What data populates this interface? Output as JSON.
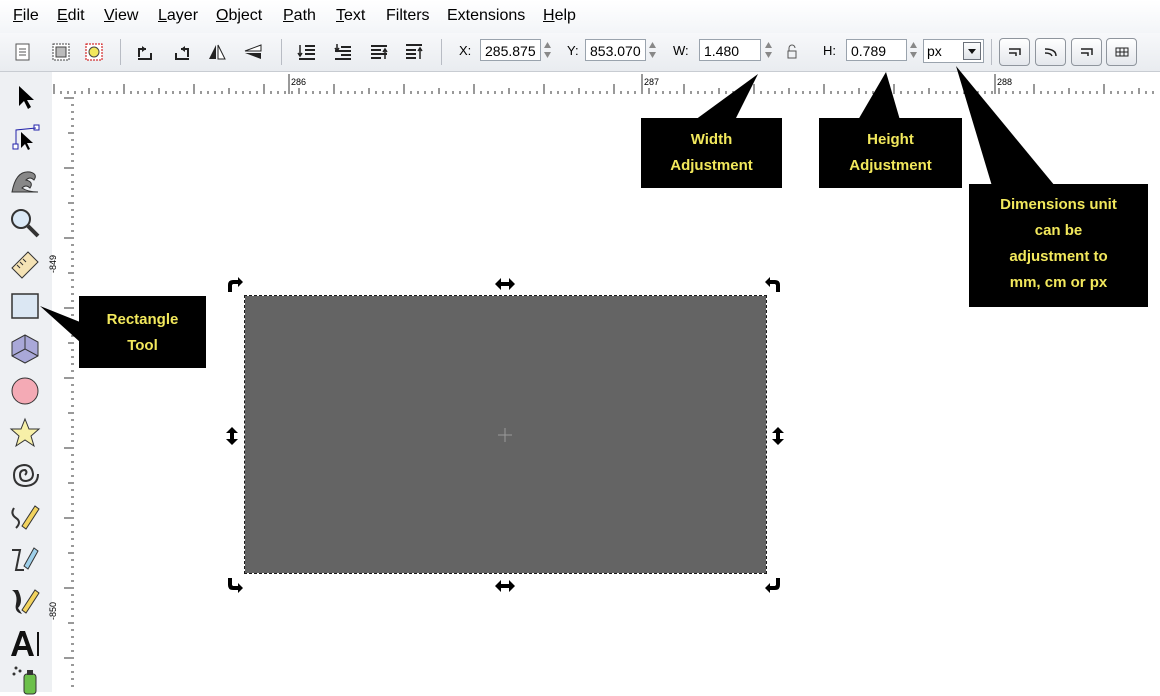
{
  "menu": {
    "items": [
      {
        "label": "File",
        "underline": "F",
        "rest": "ile"
      },
      {
        "label": "Edit",
        "underline": "E",
        "rest": "dit"
      },
      {
        "label": "View",
        "underline": "V",
        "rest": "iew"
      },
      {
        "label": "Layer",
        "underline": "L",
        "rest": "ayer"
      },
      {
        "label": "Object",
        "underline": "O",
        "rest": "bject"
      },
      {
        "label": "Path",
        "underline": "P",
        "rest": "ath"
      },
      {
        "label": "Text",
        "underline": "T",
        "rest": "ext"
      },
      {
        "label": "Filters",
        "underline": "",
        "rest": "Filters"
      },
      {
        "label": "Extensions",
        "underline": "",
        "rest": "Extensions"
      },
      {
        "label": "Help",
        "underline": "H",
        "rest": "elp"
      }
    ]
  },
  "toolbar": {
    "x_label": "X:",
    "x_value": "285.875",
    "y_label": "Y:",
    "y_value": "853.070",
    "w_label": "W:",
    "w_value": "1.480",
    "h_label": "H:",
    "h_value": "0.789",
    "unit_value": "px"
  },
  "ruler": {
    "h_labels": [
      "286",
      "287",
      "288"
    ],
    "v_labels": [
      "-849",
      "-850"
    ]
  },
  "callouts": {
    "width": [
      "Width",
      "Adjustment"
    ],
    "height": [
      "Height",
      "Adjustment"
    ],
    "units": [
      "Dimensions unit",
      "can be",
      "adjustment to",
      "mm, cm or px"
    ],
    "rectangle": [
      "Rectangle",
      "Tool"
    ]
  },
  "colors": {
    "callout_bg": "#000000",
    "callout_text": "#f2e85c",
    "rectangle_fill": "#646464"
  }
}
